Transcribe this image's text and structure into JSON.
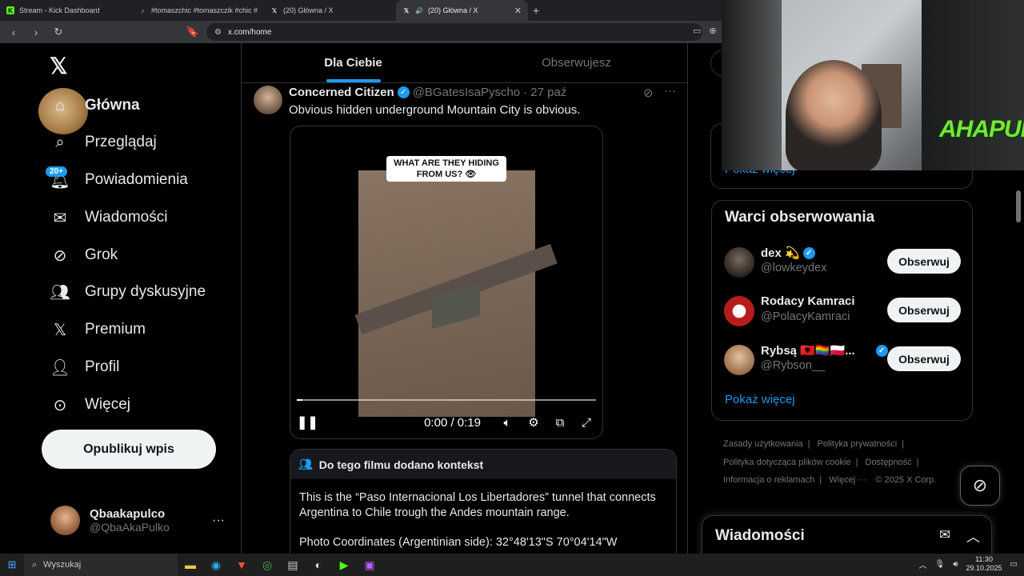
{
  "browser": {
    "tabs": [
      {
        "title": "Stream - Kick Dashboard",
        "icon": "K",
        "icon_color": "#53fc18",
        "active": false
      },
      {
        "title": "#tomaszchic #tomaszczik #chic #czik",
        "icon": "♪",
        "icon_color": "#ffffff",
        "active": false
      },
      {
        "title": "(20) Główna / X",
        "icon": "𝕏",
        "icon_color": "#ffffff",
        "active": false
      },
      {
        "title": "(20) Główna / X",
        "icon": "𝕏",
        "icon_color": "#ffffff",
        "active": true
      }
    ],
    "url": "x.com/home"
  },
  "sidebar": {
    "items": [
      {
        "label": "Główna",
        "icon": "home-icon"
      },
      {
        "label": "Przeglądaj",
        "icon": "search-icon"
      },
      {
        "label": "Powiadomienia",
        "icon": "bell-icon"
      },
      {
        "label": "Wiadomości",
        "icon": "mail-icon"
      },
      {
        "label": "Grok",
        "icon": "grok-icon"
      },
      {
        "label": "Grupy dyskusyjne",
        "icon": "people-icon"
      },
      {
        "label": "Premium",
        "icon": "x-icon"
      },
      {
        "label": "Profil",
        "icon": "person-icon"
      },
      {
        "label": "Więcej",
        "icon": "more-circle-icon"
      }
    ],
    "notifications_badge": "20+",
    "post_button": "Opublikuj wpis",
    "account": {
      "name": "Qbaakapulco",
      "handle": "@QbaAkaPulko"
    }
  },
  "feed": {
    "tabs": [
      {
        "label": "Dla Ciebie",
        "active": true
      },
      {
        "label": "Obserwujesz",
        "active": false
      }
    ],
    "tweet": {
      "author": "Concerned Citizen",
      "handle": "@BGatesIsaPyscho",
      "time": "· 27 paź",
      "text": "Obvious hidden underground Mountain City is obvious.",
      "video": {
        "caption": "WHAT ARE THEY HIDING FROM US? 👁",
        "time": "0:00 / 0:19",
        "progress": 0.02
      },
      "note": {
        "header": "Do tego filmu dodano kontekst",
        "p1": "This is the “Paso Internacional Los Libertadores” tunnel that connects Argentina to Chile trough the Andes mountain range.",
        "p2": "Photo Coordinates (Argentinian side): 32°48'13\"S 70°04'14\"W"
      }
    }
  },
  "right": {
    "trends_more": "Pokaż więcej",
    "who_to_follow": {
      "title": "Warci obserwowania",
      "items": [
        {
          "name": "dex 💫",
          "handle": "@lowkeydex",
          "verified": true,
          "button": "Obserwuj",
          "avatar_color": "#3a3530"
        },
        {
          "name": "Rodacy Kamraci",
          "handle": "@PolacyKamraci",
          "verified": false,
          "button": "Obserwuj",
          "avatar_color": "#b71c1c"
        },
        {
          "name": "Rybsą 🇦🇱🏳️‍🌈🇵🇱...",
          "handle": "@Rybson__",
          "verified": true,
          "button": "Obserwuj",
          "avatar_color": "#c9a27a"
        }
      ],
      "more": "Pokaż więcej"
    },
    "footer": {
      "links": [
        "Zasady użytkowania",
        "Polityka prywatności",
        "Polityka dotycząca plików cookie",
        "Dostępność",
        "Informacja o reklamach",
        "Więcej ···",
        "© 2025 X Corp."
      ]
    },
    "messages_title": "Wiadomości"
  },
  "webcam": {
    "overlay_text": "AHAPULCO"
  },
  "taskbar": {
    "search_placeholder": "Wyszukaj",
    "time": "11:30",
    "date": "29.10.2025"
  }
}
